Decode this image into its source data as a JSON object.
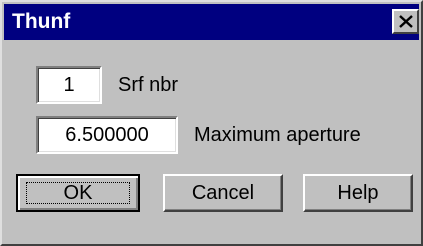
{
  "window": {
    "title": "Thunf"
  },
  "fields": [
    {
      "value": "1",
      "label": "Srf nbr"
    },
    {
      "value": "6.500000",
      "label": "Maximum aperture"
    }
  ],
  "buttons": {
    "ok": "OK",
    "cancel": "Cancel",
    "help": "Help"
  },
  "colors": {
    "titlebar": "#000080",
    "face": "#c0c0c0"
  }
}
